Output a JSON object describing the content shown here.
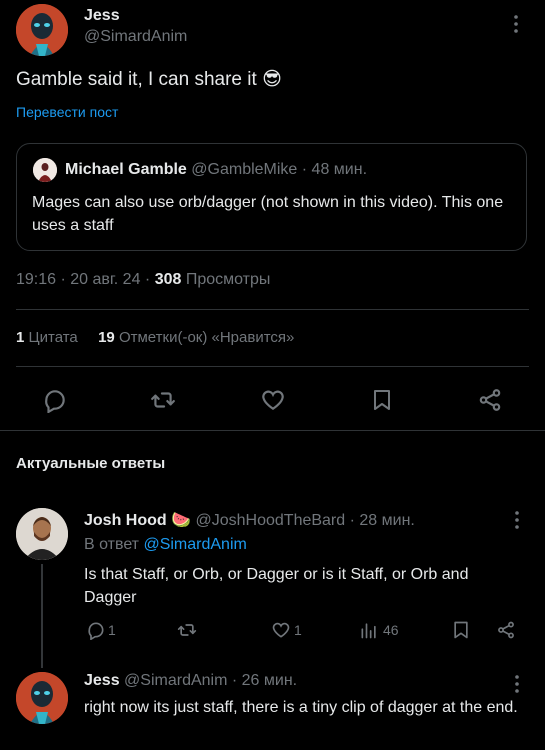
{
  "post": {
    "author_name": "Jess",
    "author_handle": "@SimardAnim",
    "text": "Gamble said it, I can share it",
    "emoji": "😎",
    "translate": "Перевести пост",
    "meta_time": "19:16 · 20 авг. 24 · ",
    "views_count": "308",
    "views_label": " Просмотры",
    "quotes_count": "1",
    "quotes_label": " Цитата",
    "likes_count": "19",
    "likes_label": " Отметки(-ок) «Нравится»"
  },
  "quoted": {
    "author_name": "Michael Gamble",
    "author_handle": "@GambleMike",
    "time": "· 48 мин.",
    "text": "Mages can also use orb/dagger (not shown in this video). This one uses a staff"
  },
  "section_title": "Актуальные ответы",
  "replies": [
    {
      "author_name": "Josh Hood",
      "emoji": "🍉",
      "author_handle": "@JoshHoodTheBard",
      "time": "· 28 мин.",
      "reply_to_label": "В ответ ",
      "reply_to_handle": "@SimardAnim",
      "text": "Is that Staff, or Orb, or Dagger or is it Staff, or Orb and Dagger",
      "replies_count": "1",
      "likes_count": "1",
      "views_count": "46"
    },
    {
      "author_name": "Jess",
      "author_handle": "@SimardAnim",
      "time": "· 26 мин.",
      "text": "right now its just staff, there is a tiny clip of dagger at the end."
    }
  ],
  "colors": {
    "background": "#000000",
    "text": "#e7e9ea",
    "muted": "#71767b",
    "link": "#1d9bf0",
    "divider": "#2f3336"
  }
}
